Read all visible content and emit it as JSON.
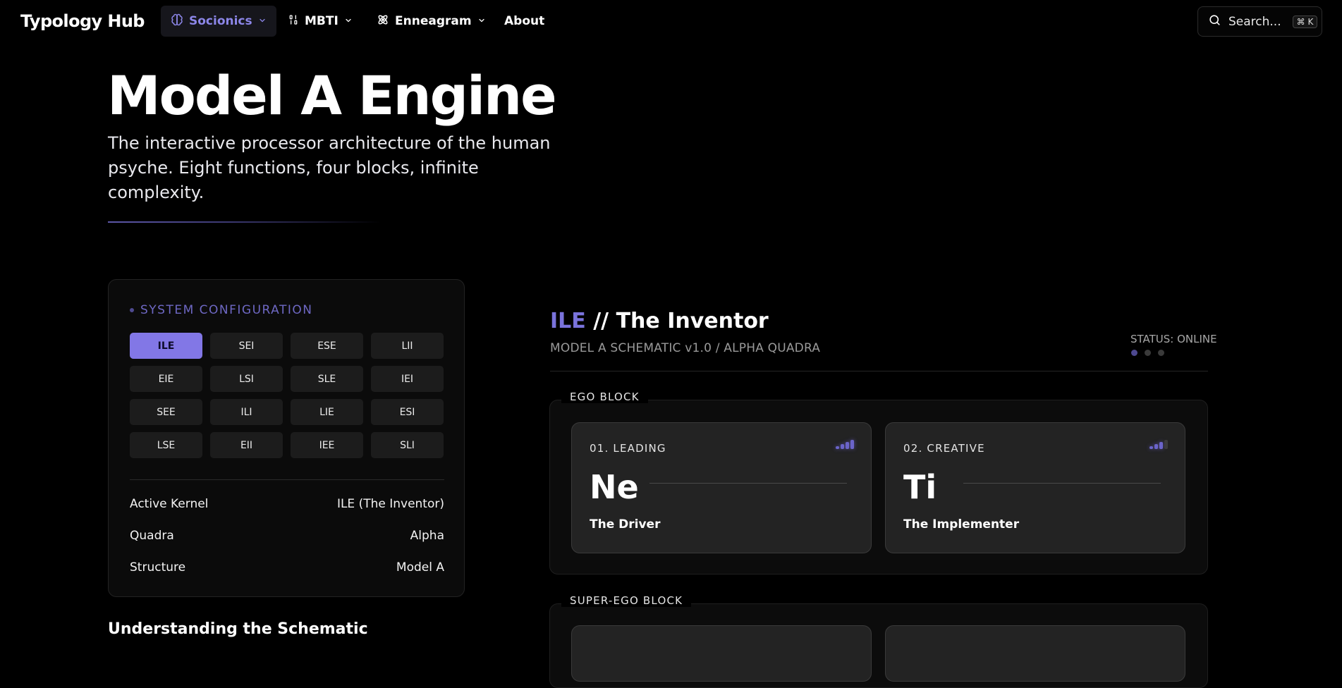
{
  "nav": {
    "brand": "Typology Hub",
    "items": [
      {
        "label": "Socionics",
        "icon": "brain-icon",
        "dropdown": true,
        "active": true
      },
      {
        "label": "MBTI",
        "icon": "code-icon",
        "dropdown": true,
        "active": false
      },
      {
        "label": "Enneagram",
        "icon": "atom-icon",
        "dropdown": true,
        "active": false
      },
      {
        "label": "About",
        "dropdown": false,
        "active": false
      }
    ],
    "search": {
      "label": "Search...",
      "shortcut": "⌘ K"
    }
  },
  "hero": {
    "title": "Model A Engine",
    "subtitle": "The interactive processor architecture of the human psyche. Eight functions, four blocks, infinite complexity."
  },
  "config": {
    "title": "SYSTEM CONFIGURATION",
    "types": [
      "ILE",
      "SEI",
      "ESE",
      "LII",
      "EIE",
      "LSI",
      "SLE",
      "IEI",
      "SEE",
      "ILI",
      "LIE",
      "ESI",
      "LSE",
      "EII",
      "IEE",
      "SLI"
    ],
    "selected": "ILE",
    "details": [
      {
        "key": "Active Kernel",
        "value": "ILE (The Inventor)"
      },
      {
        "key": "Quadra",
        "value": "Alpha"
      },
      {
        "key": "Structure",
        "value": "Model A"
      }
    ]
  },
  "understanding_heading": "Understanding the Schematic",
  "schematic": {
    "code": "ILE",
    "separator": " // ",
    "name": "The Inventor",
    "subtitle": "MODEL A SCHEMATIC v1.0 / ALPHA QUADRA",
    "status": "STATUS: ONLINE",
    "blocks": [
      {
        "label": "EGO BLOCK",
        "functions": [
          {
            "position": "01. LEADING",
            "symbol": "Ne",
            "name": "The Driver",
            "strength": 4
          },
          {
            "position": "02. CREATIVE",
            "symbol": "Ti",
            "name": "The Implementer",
            "strength": 3
          }
        ]
      },
      {
        "label": "SUPER-EGO BLOCK",
        "functions": []
      }
    ]
  },
  "colors": {
    "accent": "#8277e6",
    "accent_text": "#7a73dc",
    "background": "#000000",
    "card": "#232323"
  }
}
